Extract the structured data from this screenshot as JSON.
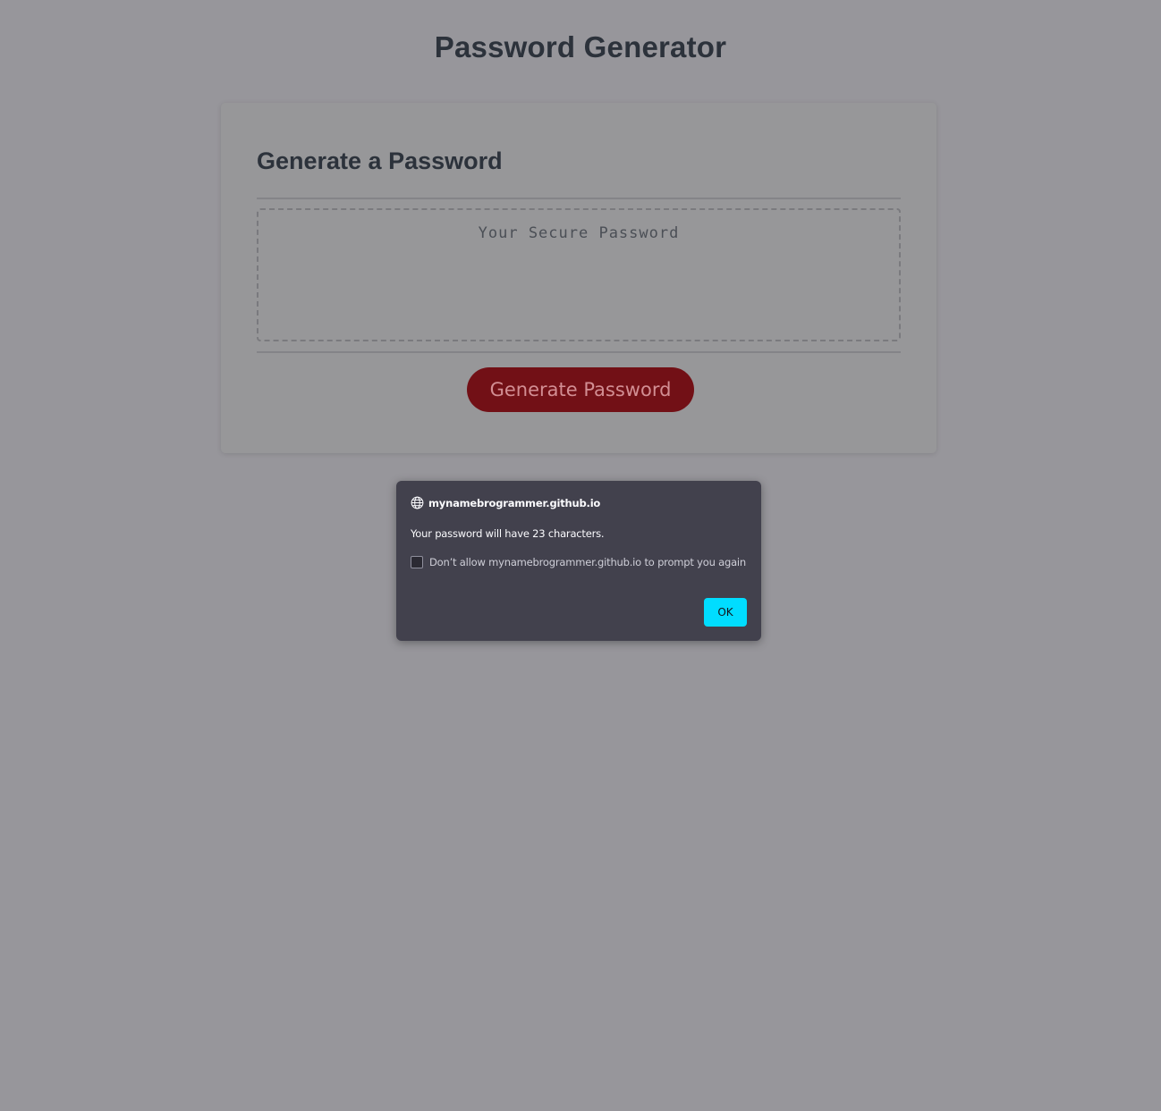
{
  "page": {
    "title": "Password Generator"
  },
  "card": {
    "heading": "Generate a Password",
    "password_placeholder": "Your Secure Password",
    "password_value": "",
    "generate_button_label": "Generate Password"
  },
  "dialog": {
    "origin": "mynamebrogrammer.github.io",
    "message": "Your password will have 23 characters.",
    "checkbox_label": "Don’t allow mynamebrogrammer.github.io to prompt you again",
    "checkbox_checked": false,
    "ok_label": "OK"
  },
  "colors": {
    "overlay_background": "#97969b",
    "button_accent": "#721016",
    "dialog_background": "#42414d",
    "ok_button": "#00ddff"
  }
}
